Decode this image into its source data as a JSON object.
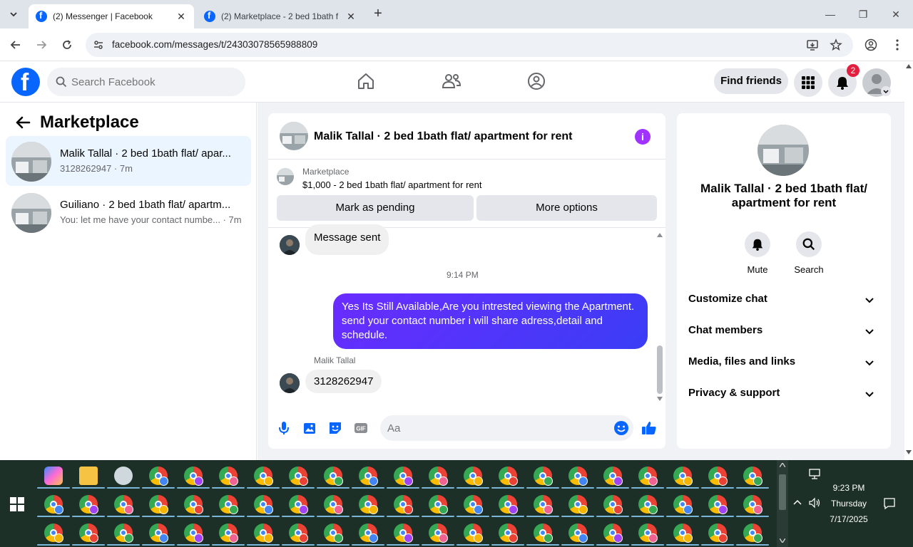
{
  "browser": {
    "tabs": [
      {
        "title": "(2) Messenger | Facebook",
        "active": true
      },
      {
        "title": "(2) Marketplace - 2 bed 1bath f",
        "active": false
      }
    ],
    "url": "facebook.com/messages/t/24303078565988809"
  },
  "fb_nav": {
    "search_placeholder": "Search Facebook",
    "find_friends": "Find friends",
    "notification_count": "2"
  },
  "left_panel": {
    "title": "Marketplace",
    "conversations": [
      {
        "name": "Malik Tallal · 2 bed 1bath flat/ apar...",
        "sub": "3128262947 · 7m",
        "selected": true
      },
      {
        "name": "Guiliano · 2 bed 1bath flat/ apartm...",
        "sub": "You: let me have your contact numbe... · 7m",
        "selected": false
      }
    ]
  },
  "chat": {
    "header_title": "Malik Tallal · 2 bed 1bath flat/ apartment for rent",
    "marketplace_label": "Marketplace",
    "listing": "$1,000 - 2 bed 1bath flat/ apartment for rent",
    "mark_pending": "Mark as pending",
    "more_options": "More options",
    "messages": {
      "first_in": "Message sent",
      "timestamp": "9:14 PM",
      "outgoing": "Yes Its Still Available,Are you intrested viewing the Apartment. send your contact number i will share adress,detail and schedule.",
      "sender_name": "Malik Tallal",
      "last_in": "3128262947"
    },
    "composer_placeholder": "Aa"
  },
  "info_panel": {
    "name": "Malik Tallal · 2 bed 1bath flat/ apartment for rent",
    "mute": "Mute",
    "search": "Search",
    "sections": [
      "Customize chat",
      "Chat members",
      "Media, files and links",
      "Privacy & support"
    ]
  },
  "taskbar": {
    "time": "9:23 PM",
    "day": "Thursday",
    "date": "7/17/2025"
  },
  "colors": {
    "fb_blue": "#0866ff",
    "bubble_out": "#5b2ffa",
    "taskbar": "#1c3028"
  }
}
